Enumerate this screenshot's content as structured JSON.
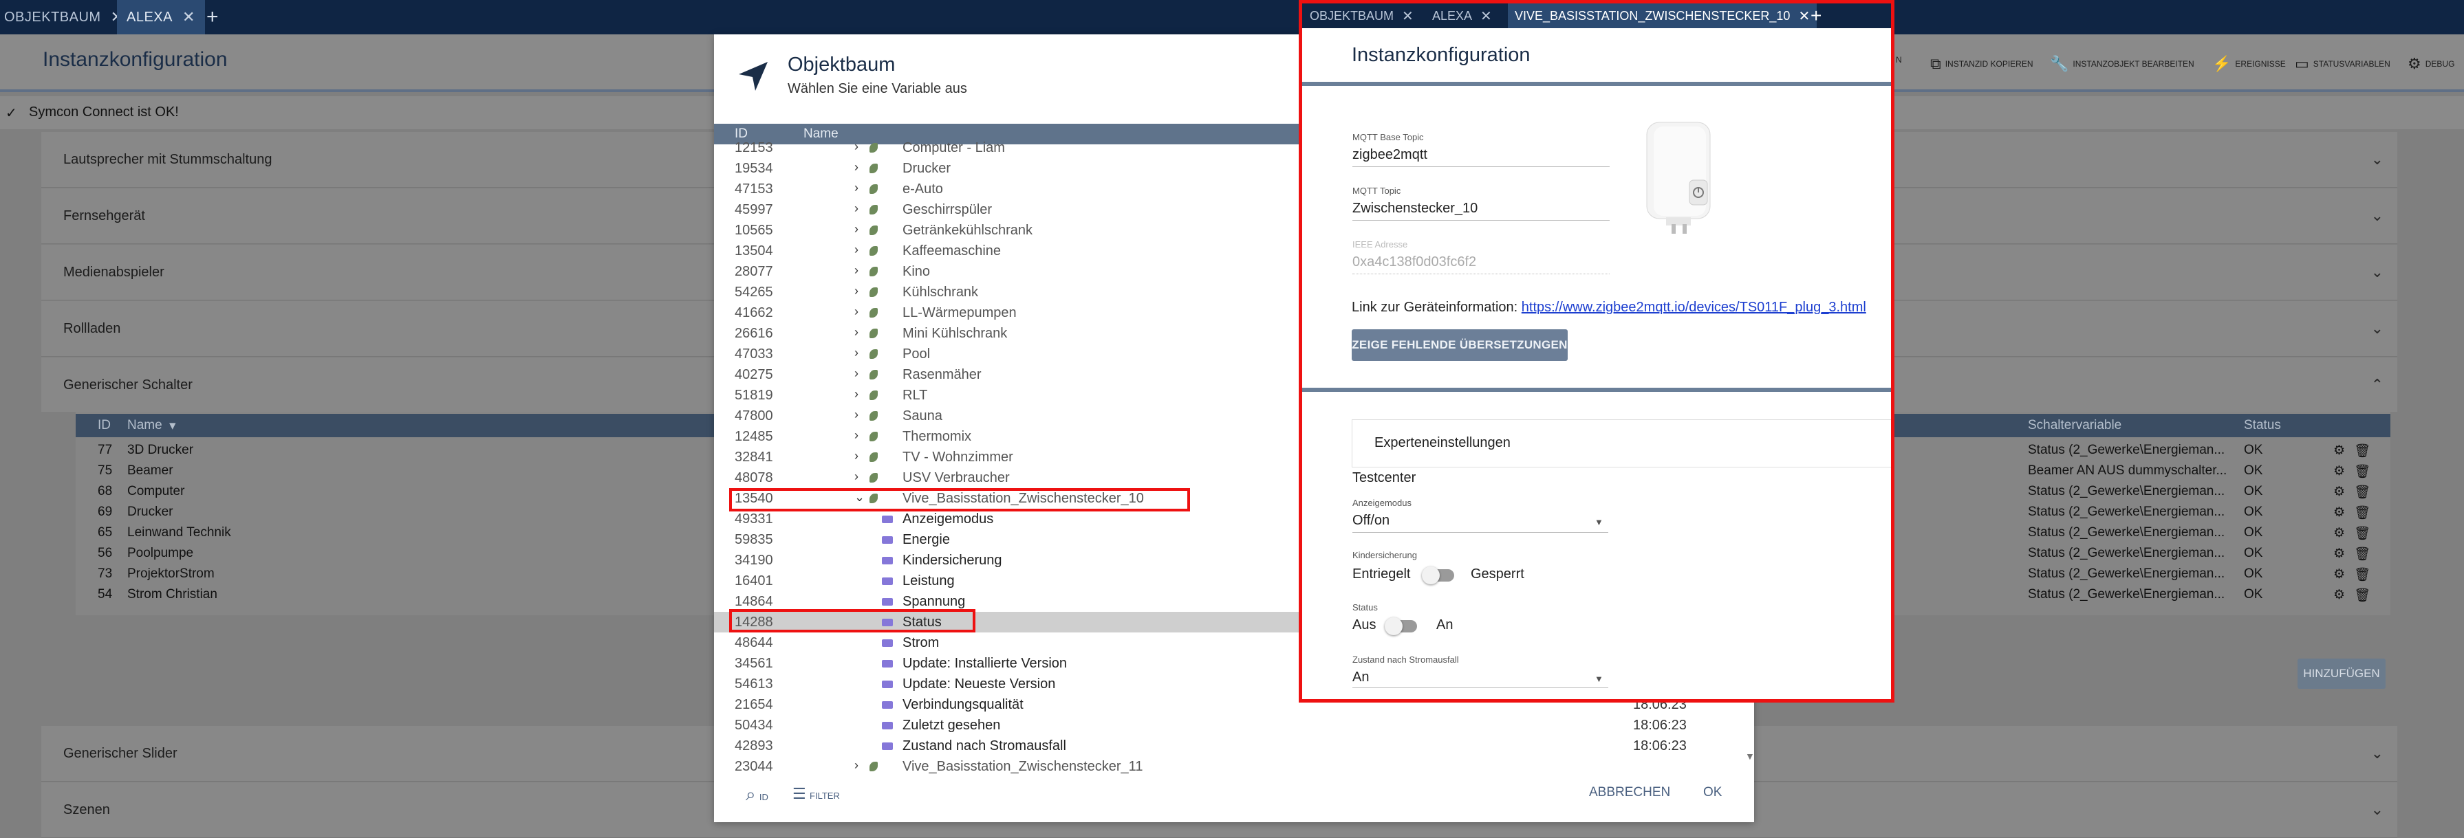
{
  "tabs": [
    {
      "label": "OBJEKTBAUM",
      "active": false
    },
    {
      "label": "ALEXA",
      "active": true
    }
  ],
  "header": {
    "title": "Instanzkonfiguration",
    "tools": [
      {
        "icon": "copy-icon",
        "label": "INSTANZID KOPIEREN"
      },
      {
        "icon": "wrench-icon",
        "label": "INSTANZOBJEKT BEARBEITEN"
      },
      {
        "icon": "lightning-icon",
        "label": "EREIGNISSE"
      },
      {
        "icon": "tag-icon",
        "label": "STATUSVARIABLEN"
      },
      {
        "icon": "gear-icon",
        "label": "DEBUG"
      }
    ],
    "tools_partial_label": "N"
  },
  "connect_status": "Symcon Connect ist OK!",
  "sections": [
    "Lautsprecher mit Stummschaltung",
    "Fernsehgerät",
    "Medienabspieler",
    "Rollladen",
    "Generischer Schalter",
    "Generischer Slider",
    "Szenen"
  ],
  "switch_table": {
    "columns": {
      "id": "ID",
      "name": "Name",
      "variable": "Schaltervariable",
      "status": "Status"
    },
    "rows": [
      {
        "id": "77",
        "name": "3D Drucker",
        "variable": "Status (2_Gewerke\\Energieman...",
        "status": "OK"
      },
      {
        "id": "75",
        "name": "Beamer",
        "variable": "Beamer AN AUS dummyschalter...",
        "status": "OK"
      },
      {
        "id": "68",
        "name": "Computer",
        "variable": "Status (2_Gewerke\\Energieman...",
        "status": "OK"
      },
      {
        "id": "69",
        "name": "Drucker",
        "variable": "Status (2_Gewerke\\Energieman...",
        "status": "OK"
      },
      {
        "id": "65",
        "name": "Leinwand Technik",
        "variable": "Status (2_Gewerke\\Energieman...",
        "status": "OK"
      },
      {
        "id": "56",
        "name": "Poolpumpe",
        "variable": "Status (2_Gewerke\\Energieman...",
        "status": "OK"
      },
      {
        "id": "73",
        "name": "ProjektorStrom",
        "variable": "Status (2_Gewerke\\Energieman...",
        "status": "OK"
      },
      {
        "id": "54",
        "name": "Strom Christian",
        "variable": "Status (2_Gewerke\\Energieman...",
        "status": "OK"
      }
    ],
    "add_button": "HINZUFÜGEN"
  },
  "dialog": {
    "title": "Objektbaum",
    "subtitle": "Wählen Sie eine Variable aus",
    "columns": {
      "id": "ID",
      "name": "Name"
    },
    "rows": [
      {
        "id": "12153",
        "name": "Computer - Liam",
        "type": "instance"
      },
      {
        "id": "19534",
        "name": "Drucker",
        "type": "instance"
      },
      {
        "id": "47153",
        "name": "e-Auto",
        "type": "instance"
      },
      {
        "id": "45997",
        "name": "Geschirrspüler",
        "type": "instance"
      },
      {
        "id": "10565",
        "name": "Getränkekühlschrank",
        "type": "instance"
      },
      {
        "id": "13504",
        "name": "Kaffeemaschine",
        "type": "instance"
      },
      {
        "id": "28077",
        "name": "Kino",
        "type": "instance"
      },
      {
        "id": "54265",
        "name": "Kühlschrank",
        "type": "instance"
      },
      {
        "id": "41662",
        "name": "LL-Wärmepumpen",
        "type": "instance"
      },
      {
        "id": "26616",
        "name": "Mini Kühlschrank",
        "type": "instance"
      },
      {
        "id": "47033",
        "name": "Pool",
        "type": "instance"
      },
      {
        "id": "40275",
        "name": "Rasenmäher",
        "type": "instance"
      },
      {
        "id": "51819",
        "name": "RLT",
        "type": "instance"
      },
      {
        "id": "47800",
        "name": "Sauna",
        "type": "instance"
      },
      {
        "id": "12485",
        "name": "Thermomix",
        "type": "instance"
      },
      {
        "id": "32841",
        "name": "TV - Wohnzimmer",
        "type": "instance"
      },
      {
        "id": "48078",
        "name": "USV Verbraucher",
        "type": "instance"
      },
      {
        "id": "13540",
        "name": "Vive_Basisstation_Zwischenstecker_10",
        "type": "expanded"
      },
      {
        "id": "49331",
        "name": "Anzeigemodus",
        "type": "variable"
      },
      {
        "id": "59835",
        "name": "Energie",
        "type": "variable"
      },
      {
        "id": "34190",
        "name": "Kindersicherung",
        "type": "variable"
      },
      {
        "id": "16401",
        "name": "Leistung",
        "type": "variable"
      },
      {
        "id": "14864",
        "name": "Spannung",
        "type": "variable"
      },
      {
        "id": "14288",
        "name": "Status",
        "type": "variable",
        "selected": true
      },
      {
        "id": "48644",
        "name": "Strom",
        "type": "variable"
      },
      {
        "id": "34561",
        "name": "Update: Installierte Version",
        "type": "variable"
      },
      {
        "id": "54613",
        "name": "Update: Neueste Version",
        "type": "variable"
      },
      {
        "id": "21654",
        "name": "Verbindungsqualität",
        "type": "variable",
        "time": "18:06:23"
      },
      {
        "id": "50434",
        "name": "Zuletzt gesehen",
        "type": "variable",
        "time": "18:06:23"
      },
      {
        "id": "42893",
        "name": "Zustand nach Stromausfall",
        "type": "variable",
        "time": "18:06:23"
      },
      {
        "id": "23044",
        "name": "Vive_Basisstation_Zwischenstecker_11",
        "type": "instance"
      }
    ],
    "footer": {
      "search_label": "ID",
      "filter_label": "FILTER",
      "cancel": "ABBRECHEN",
      "ok": "OK"
    }
  },
  "overlay": {
    "tabs": [
      {
        "label": "OBJEKTBAUM",
        "active": false
      },
      {
        "label": "ALEXA",
        "active": false
      },
      {
        "label": "VIVE_BASISSTATION_ZWISCHENSTECKER_10",
        "active": true
      }
    ],
    "title": "Instanzkonfiguration",
    "fields": [
      {
        "label": "MQTT Base Topic",
        "value": "zigbee2mqtt",
        "disabled": false
      },
      {
        "label": "MQTT Topic",
        "value": "Zwischenstecker_10",
        "disabled": false
      },
      {
        "label": "IEEE Adresse",
        "value": "0xa4c138f0d03fc6f2",
        "disabled": true
      }
    ],
    "link_prefix": "Link zur Geräteinformation:",
    "link_url": "https://www.zigbee2mqtt.io/devices/TS011F_plug_3.html",
    "missing_translations_button": "ZEIGE FEHLENDE ÜBERSETZUNGEN",
    "expert_settings": "Experteneinstellungen",
    "testcenter": "Testcenter",
    "anzeigemodus": {
      "label": "Anzeigemodus",
      "value": "Off/on"
    },
    "kindersicherung": {
      "label": "Kindersicherung",
      "off_label": "Entriegelt",
      "on_label": "Gesperrt"
    },
    "status": {
      "label": "Status",
      "off_label": "Aus",
      "on_label": "An"
    },
    "zustand": {
      "label": "Zustand nach Stromausfall",
      "value": "An"
    }
  },
  "colors": {
    "accent": "#1a2d47",
    "highlight": "#ee1111",
    "header": "#5f738b"
  }
}
